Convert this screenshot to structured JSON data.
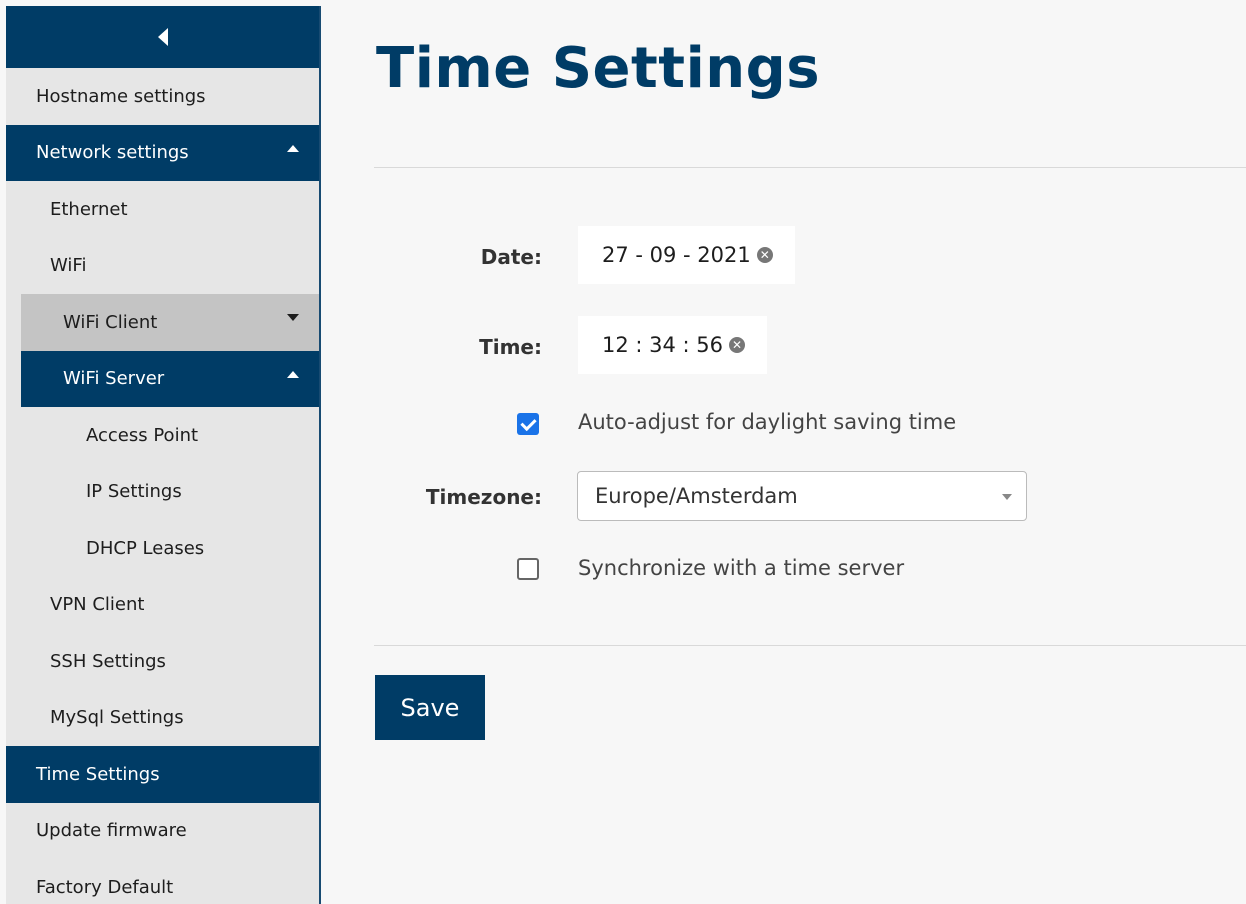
{
  "sidebar": {
    "items": [
      {
        "label": "Hostname settings"
      },
      {
        "label": "Network settings"
      },
      {
        "label": "Ethernet"
      },
      {
        "label": "WiFi"
      },
      {
        "label": "WiFi Client"
      },
      {
        "label": "WiFi Server"
      },
      {
        "label": "Access Point"
      },
      {
        "label": "IP Settings"
      },
      {
        "label": "DHCP Leases"
      },
      {
        "label": "VPN Client"
      },
      {
        "label": "SSH Settings"
      },
      {
        "label": "MySql Settings"
      },
      {
        "label": "Time Settings"
      },
      {
        "label": "Update firmware"
      },
      {
        "label": "Factory Default"
      }
    ]
  },
  "page": {
    "title": "Time Settings"
  },
  "form": {
    "date_label": "Date:",
    "date_value": "27 - 09 - 2021",
    "time_label": "Time:",
    "time_value": "12 : 34 : 56",
    "dst_checked": true,
    "dst_label": "Auto-adjust for daylight saving time",
    "timezone_label": "Timezone:",
    "timezone_value": "Europe/Amsterdam",
    "sync_checked": false,
    "sync_label": "Synchronize with a time server",
    "save_label": "Save"
  },
  "colors": {
    "primary": "#003c66",
    "checkbox_checked": "#1a73e8",
    "sidebar_bg": "#e6e6e6",
    "submenu_closed": "#c4c4c4"
  },
  "icons": {
    "collapse": "chevron-left-icon",
    "clear": "clear-circle-icon",
    "caret_up": "caret-up-icon",
    "caret_down": "caret-down-icon"
  }
}
